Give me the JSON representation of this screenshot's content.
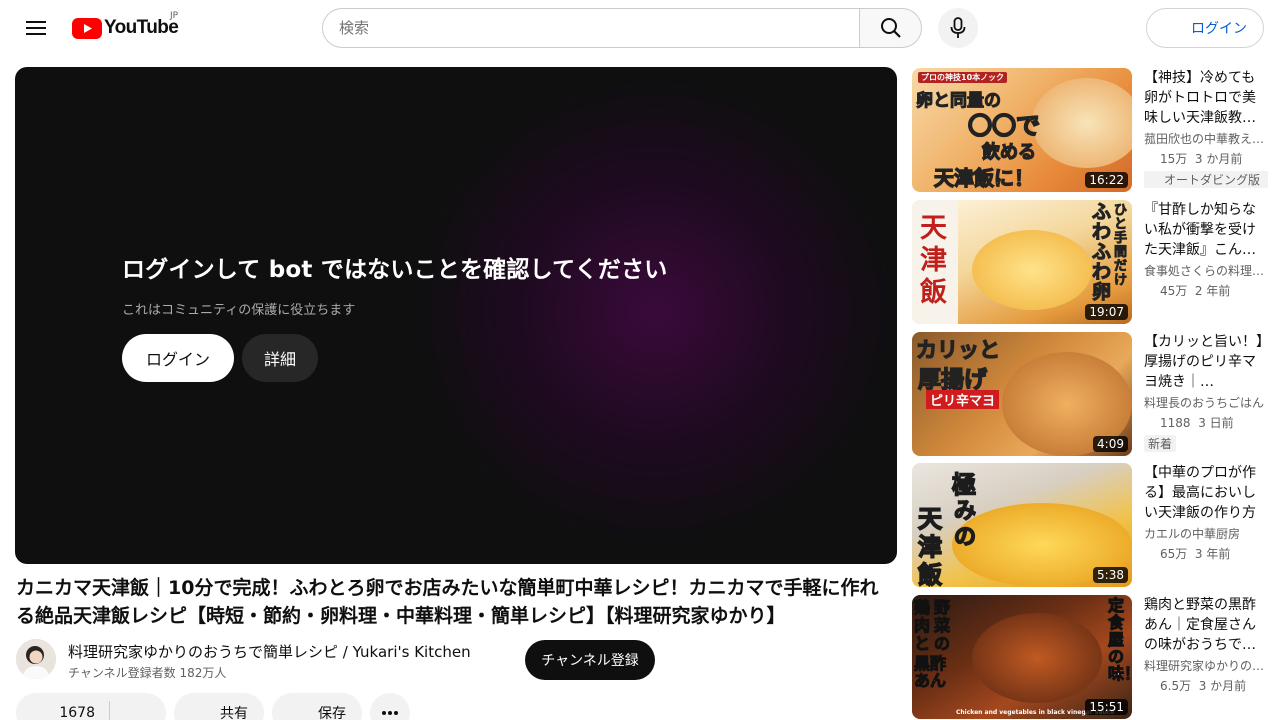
{
  "header": {
    "logo_text": "YouTube",
    "region": "JP",
    "search_placeholder": "検索",
    "login_label": "ログイン"
  },
  "player": {
    "title": "ログインして bot ではないことを確認してください",
    "subtitle": "これはコミュニティの保護に役立ちます",
    "login_label": "ログイン",
    "details_label": "詳細"
  },
  "video": {
    "title": "カニカマ天津飯｜10分で完成！ふわとろ卵でお店みたいな簡単町中華レシピ！カニカマで手軽に作れる絶品天津飯レシピ【時短・節約・卵料理・中華料理・簡単レシピ】【料理研究家ゆかり】",
    "channel_name": "料理研究家ゆかりのおうちで簡単レシピ / Yukari's Kitchen",
    "channel_subs": "チャンネル登録者数 182万人",
    "subscribe_label": "チャンネル登録",
    "likes": "1678",
    "share_label": "共有",
    "save_label": "保存"
  },
  "recommendations": [
    {
      "title": "【神技】冷めても卵がトロトロで美味しい天津飯教…",
      "channel": "菰田欣也の中華教え…",
      "views": "15万",
      "age": "3 か月前",
      "badge": "オートダビング版",
      "duration": "16:22",
      "thumb_lines": [
        "プロの神技10本ノック",
        "卵と同量の",
        "〇〇で",
        "飲める",
        "天津飯に！"
      ]
    },
    {
      "title": "『甘酢しか知らない私が衝撃を受けた天津飯』こん…",
      "channel": "食事処さくらの料理…",
      "views": "45万",
      "age": "2 年前",
      "badge": "",
      "duration": "19:07",
      "thumb_lines": [
        "天",
        "津",
        "飯",
        "ひと手間だけ",
        "ふわふわ卵"
      ]
    },
    {
      "title": "【カリッと旨い！】厚揚げのピリ辛マヨ焼き｜…",
      "channel": "料理長のおうちごはん",
      "views": "1188",
      "age": "3 日前",
      "badge": "新着",
      "duration": "4:09",
      "thumb_lines": [
        "カリッと",
        "厚揚げ",
        "ピリ辛マヨ"
      ]
    },
    {
      "title": "【中華のプロが作る】最高においしい天津飯の作り方",
      "channel": "カエルの中華厨房",
      "views": "65万",
      "age": "3 年前",
      "badge": "",
      "duration": "5:38",
      "thumb_lines": [
        "極",
        "み",
        "の",
        "天",
        "津",
        "飯"
      ]
    },
    {
      "title": "鶏肉と野菜の黒酢あん｜定食屋さんの味がおうちで…",
      "channel": "料理研究家ゆかりの…",
      "views": "6.5万",
      "age": "3 か月前",
      "badge": "",
      "duration": "15:51",
      "thumb_lines": [
        "鶏肉と",
        "野菜の",
        "黒酢あん",
        "定食屋の味！",
        "Chicken and vegetables in black vinegar sauce"
      ]
    }
  ]
}
